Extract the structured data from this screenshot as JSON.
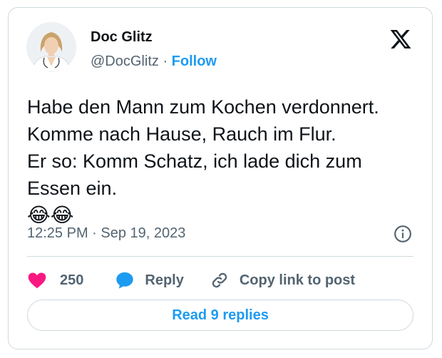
{
  "author": {
    "name": "Doc Glitz",
    "handle": "@DocGlitz",
    "separator": "·",
    "follow_label": "Follow"
  },
  "icons": {
    "brand_logo": "x-logo-icon",
    "info": "info-circle-icon",
    "like": "heart-icon",
    "reply": "speech-bubble-icon",
    "copy": "link-icon"
  },
  "tweet": {
    "lines": [
      "Habe den Mann zum Kochen verdonnert.",
      "Komme nach Hause, Rauch im Flur.",
      "Er so: Komm Schatz, ich lade dich zum",
      "Essen ein.",
      "😂😂"
    ],
    "timestamp": "12:25 PM · Sep 19, 2023"
  },
  "actions": {
    "like_count": "250",
    "reply_label": "Reply",
    "copy_label": "Copy link to post"
  },
  "read_replies_label": "Read 9 replies",
  "colors": {
    "accent": "#1d9bf0",
    "like": "#f91880",
    "text": "#0f1419",
    "secondary": "#536471",
    "border": "#cfd9de"
  }
}
